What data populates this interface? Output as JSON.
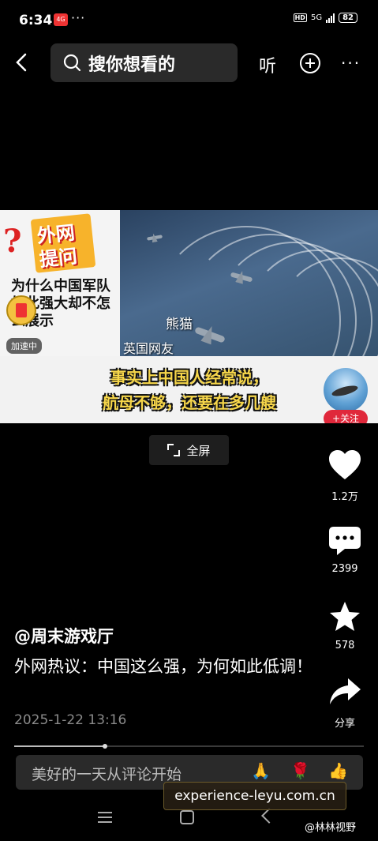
{
  "status_bar": {
    "time": "6:34",
    "app_badge": "4G",
    "overflow": "···",
    "hd": "HD",
    "network": "5G",
    "battery": "82"
  },
  "top_nav": {
    "search_placeholder": "搜你想看的",
    "listen_label": "听"
  },
  "video": {
    "left_sticker_line1": "外网",
    "left_sticker_line2": "提问",
    "left_question": "为什么中国军队如此强大却不怎么展示",
    "speed_badge": "加速中",
    "caption_name": "熊猫",
    "caption_source": "英国网友",
    "subtitle_line1": "事实上中国人经常说，",
    "subtitle_line2": "航母不够，还要在多几艘",
    "follow_label": "+关注"
  },
  "fullscreen_label": "全屏",
  "actions": {
    "likes": "1.2万",
    "comments": "2399",
    "favorites": "578",
    "share": "分享"
  },
  "post": {
    "author": "@周末游戏厅",
    "description": "外网热议：中国这么强，为何如此低调！",
    "date": "2025-1-22 13:16",
    "progress": 0.26
  },
  "comment_bar": {
    "placeholder": "美好的一天从评论开始",
    "emoji": [
      "🙏",
      "🌹",
      "👍"
    ]
  },
  "watermark": "experience-leyu.com.cn",
  "credit": "@林林视野",
  "colors": {
    "background": "#000000",
    "follow_red": "#e0283b",
    "subtitle_yellow": "#f6d64a"
  }
}
